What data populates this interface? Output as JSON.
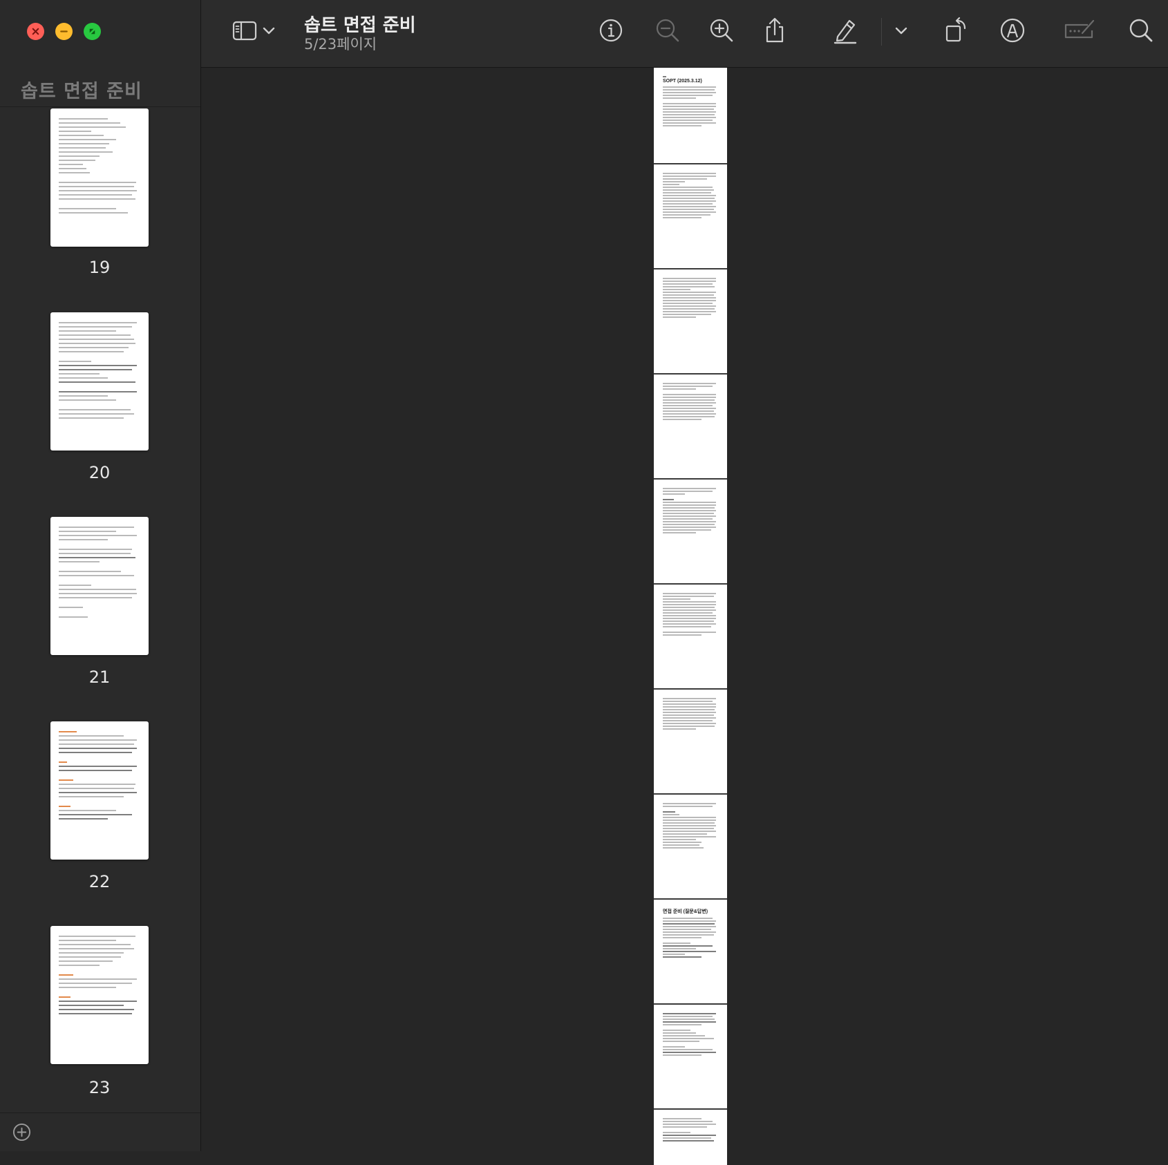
{
  "window": {
    "traffic_lights": {
      "close": "close-icon",
      "minimize": "minimize-icon",
      "zoom": "zoom-icon"
    }
  },
  "sidebar": {
    "title": "솝트 면접 준비",
    "thumbnails": [
      {
        "page": "19"
      },
      {
        "page": "20"
      },
      {
        "page": "21"
      },
      {
        "page": "22"
      },
      {
        "page": "23"
      }
    ],
    "add_icon": "plus-circle-icon"
  },
  "toolbar": {
    "title": "솝트 면접 준비",
    "subtitle": "5/23페이지",
    "icons": [
      "sidebar-toggle-icon",
      "chevron-down-icon",
      "info-icon",
      "zoom-out-icon",
      "zoom-in-icon",
      "share-icon",
      "highlight-pen-icon",
      "chevron-down-icon",
      "rotate-icon",
      "markup-icon",
      "form-fill-icon",
      "search-icon"
    ]
  },
  "document": {
    "first_page_heading": "SOPT (2025.3.12)",
    "page9_heading": "면접 준비 (질문&답변)",
    "visible_pages": 11
  },
  "colors": {
    "background": "#262626",
    "sidebar": "#2a2a2a",
    "toolbar": "#2c2c2c",
    "accent_orange": "#e2894a"
  }
}
